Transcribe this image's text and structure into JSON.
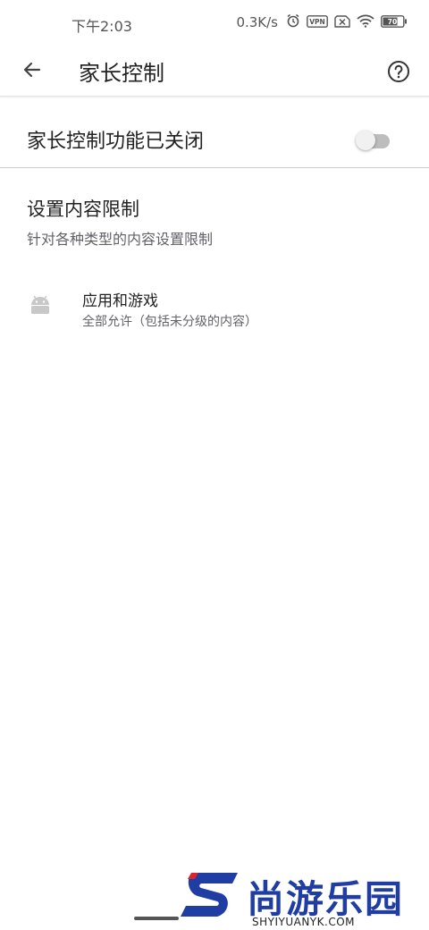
{
  "status_bar": {
    "time": "下午2:03",
    "net_speed": "0.3K/s",
    "vpn_label": "VPN",
    "battery_level": "70",
    "icons": [
      "alarm-icon",
      "vpn-icon",
      "sim-off-icon",
      "wifi-icon",
      "battery-icon"
    ]
  },
  "app_bar": {
    "title": "家长控制",
    "back_icon": "arrow-back-icon",
    "help_icon": "help-circle-icon"
  },
  "master_switch": {
    "label": "家长控制功能已关闭",
    "enabled": false
  },
  "section": {
    "title": "设置内容限制",
    "subtitle": "针对各种类型的内容设置限制"
  },
  "items": [
    {
      "icon": "android-icon",
      "title": "应用和游戏",
      "summary": "全部允许（包括未分级的内容）"
    }
  ],
  "watermark": {
    "text": "尚游乐园",
    "url": "SHYIYUANYK.COM"
  },
  "colors": {
    "watermark_blue": "#1f3da3",
    "watermark_red": "#d9262e",
    "switch_track": "#bdbdbd",
    "divider": "#cfcfcf"
  }
}
